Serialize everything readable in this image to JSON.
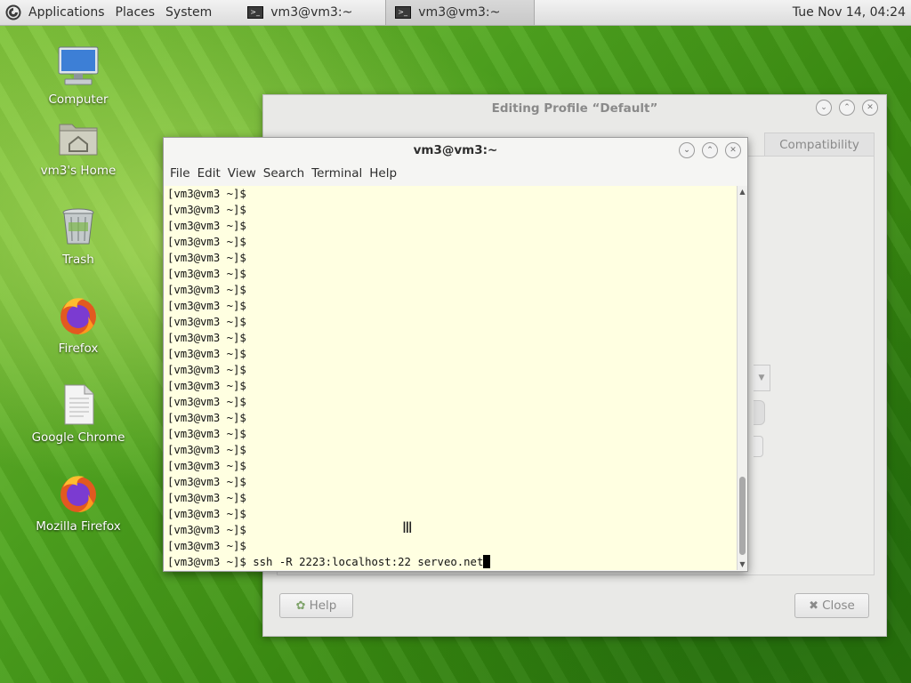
{
  "top_panel": {
    "menus": [
      "Applications",
      "Places",
      "System"
    ],
    "tasks": [
      {
        "label": "vm3@vm3:~"
      },
      {
        "label": "vm3@vm3:~"
      }
    ],
    "clock": "Tue Nov 14, 04:24"
  },
  "desktop_icons": [
    {
      "label": "Computer",
      "icon": "computer-icon"
    },
    {
      "label": "vm3's Home",
      "icon": "home-folder-icon"
    },
    {
      "label": "Trash",
      "icon": "trash-icon"
    },
    {
      "label": "Firefox",
      "icon": "firefox-icon"
    },
    {
      "label": "Google Chrome",
      "icon": "document-icon"
    },
    {
      "label": "Mozilla Firefox",
      "icon": "firefox-icon"
    }
  ],
  "profile_window": {
    "title": "Editing Profile “Default”",
    "tab_visible": "Compatibility",
    "help_label": "Help",
    "close_label": "Close"
  },
  "terminal": {
    "title": "vm3@vm3:~",
    "menu": [
      "File",
      "Edit",
      "View",
      "Search",
      "Terminal",
      "Help"
    ],
    "prompt": "[vm3@vm3 ~]$",
    "empty_prompt_count": 23,
    "command": "ssh -R 2223:localhost:22 serveo.net"
  }
}
